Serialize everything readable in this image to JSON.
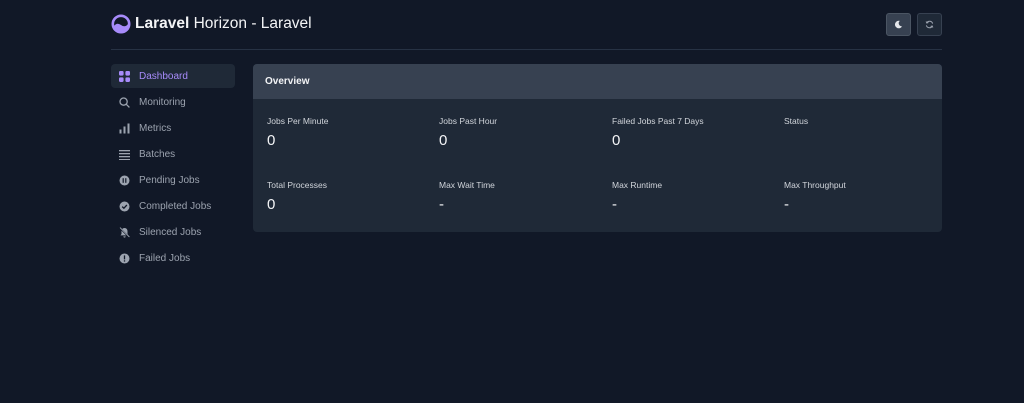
{
  "header": {
    "title_brand": "Laravel",
    "title_rest": " Horizon - Laravel",
    "theme_icon": "moon-icon",
    "refresh_icon": "refresh-icon"
  },
  "colors": {
    "accent": "#a78bfa",
    "background": "#111827",
    "card": "#1f2937",
    "card_header": "#374151"
  },
  "sidebar": {
    "items": [
      {
        "label": "Dashboard",
        "icon": "dashboard-grid-icon",
        "active": true
      },
      {
        "label": "Monitoring",
        "icon": "search-icon"
      },
      {
        "label": "Metrics",
        "icon": "bar-chart-icon"
      },
      {
        "label": "Batches",
        "icon": "list-icon"
      },
      {
        "label": "Pending Jobs",
        "icon": "pause-circle-icon"
      },
      {
        "label": "Completed Jobs",
        "icon": "check-circle-icon"
      },
      {
        "label": "Silenced Jobs",
        "icon": "bell-slash-icon"
      },
      {
        "label": "Failed Jobs",
        "icon": "exclamation-circle-icon"
      }
    ]
  },
  "overview": {
    "title": "Overview",
    "stats": [
      {
        "label": "Jobs Per Minute",
        "value": "0"
      },
      {
        "label": "Jobs Past Hour",
        "value": "0"
      },
      {
        "label": "Failed Jobs Past 7 Days",
        "value": "0"
      },
      {
        "label": "Status",
        "value": ""
      },
      {
        "label": "Total Processes",
        "value": "0"
      },
      {
        "label": "Max Wait Time",
        "value": "-"
      },
      {
        "label": "Max Runtime",
        "value": "-"
      },
      {
        "label": "Max Throughput",
        "value": "-"
      }
    ]
  }
}
